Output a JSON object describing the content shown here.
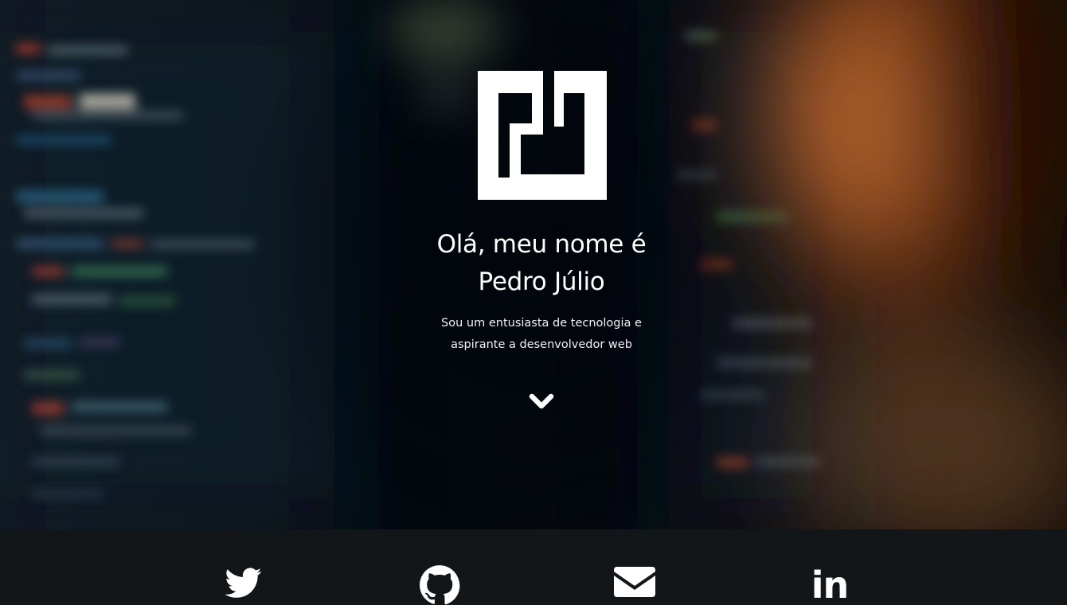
{
  "hero": {
    "logo_icon": "monogram-logo-icon",
    "title_line1": "Olá, meu nome é",
    "title_line2": "Pedro Júlio",
    "subtitle_line1": "Sou um entusiasta de tecnologia e",
    "subtitle_line2": "aspirante a desenvolvedor web",
    "scroll_icon": "chevron-down-icon"
  },
  "social": {
    "items": [
      {
        "icon": "twitter-icon"
      },
      {
        "icon": "github-icon"
      },
      {
        "icon": "envelope-icon"
      },
      {
        "icon": "linkedin-icon",
        "glyph": "in"
      }
    ]
  },
  "colors": {
    "hero_background": "#050a10",
    "footer_background": "#121619",
    "foreground": "#ffffff"
  }
}
